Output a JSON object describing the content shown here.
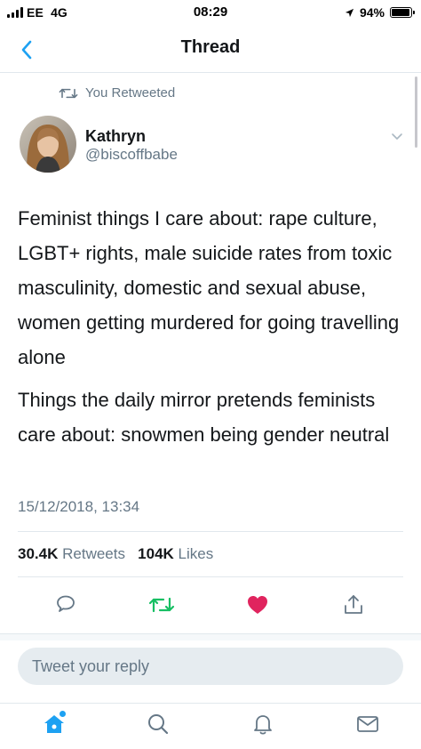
{
  "status_bar": {
    "carrier": "EE",
    "network": "4G",
    "time": "08:29",
    "battery": "94%",
    "battery_level": 0.94
  },
  "nav": {
    "title": "Thread"
  },
  "tweet": {
    "retweet_label": "You Retweeted",
    "author_name": "Kathryn",
    "author_handle": "@biscoffbabe",
    "paragraphs": [
      "Feminist things I care about: rape culture, LGBT+ rights, male suicide rates from toxic masculinity, domestic and sexual abuse, women getting murdered for going travelling alone",
      "Things the daily mirror pretends feminists care about: snowmen being gender neutral"
    ],
    "timestamp": "15/12/2018, 13:34",
    "retweet_count": "30.4K",
    "retweets_label": "Retweets",
    "like_count": "104K",
    "likes_label": "Likes"
  },
  "reply": {
    "placeholder": "Tweet your reply"
  },
  "icons": {
    "back": "chevron-left-icon",
    "retweet": "retweet-icon",
    "caret": "chevron-down-icon",
    "reply": "reply-icon",
    "like": "heart-icon",
    "share": "share-icon",
    "home": "home-icon",
    "search": "search-icon",
    "notifications": "bell-icon",
    "messages": "envelope-icon"
  },
  "colors": {
    "accent": "#1da1f2",
    "retweet_active": "#17bf63",
    "like_active": "#e0245e",
    "secondary_text": "#657786"
  }
}
